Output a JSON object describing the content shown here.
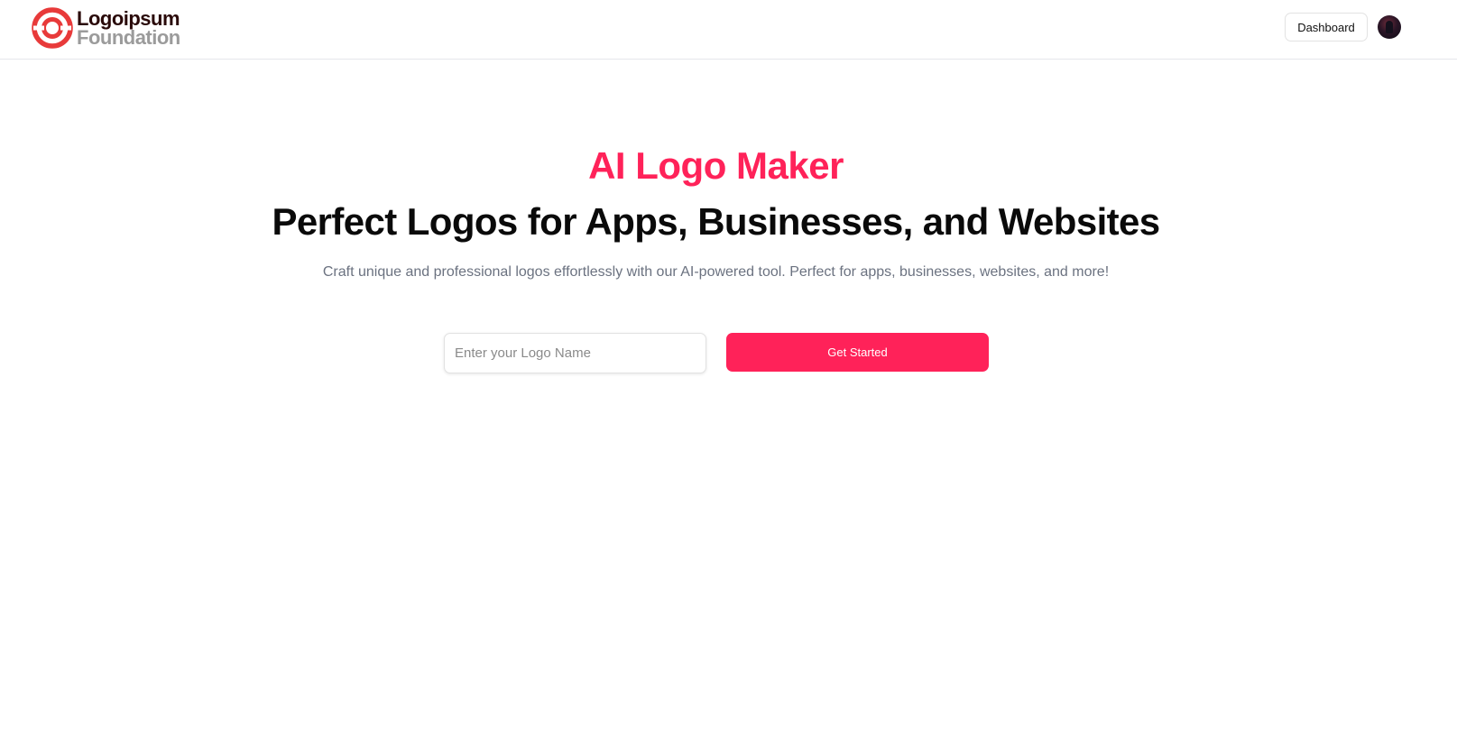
{
  "header": {
    "logo": {
      "line1": "Logoipsum",
      "line2": "Foundation",
      "icon": "logoipsum-ring-icon"
    },
    "dashboard_label": "Dashboard",
    "avatar_icon": "user-avatar"
  },
  "hero": {
    "eyebrow": "AI Logo Maker",
    "title": "Perfect Logos for Apps, Businesses, and Websites",
    "subtitle": "Craft unique and professional logos effortlessly with our AI-powered tool. Perfect for apps, businesses, websites, and more!",
    "input_placeholder": "Enter your Logo Name",
    "input_value": "",
    "cta_label": "Get Started"
  },
  "colors": {
    "accent": "#ff2259",
    "logo_red": "#e83a3a",
    "title_text": "#0a0a0a",
    "subtitle_text": "#6b7280"
  }
}
